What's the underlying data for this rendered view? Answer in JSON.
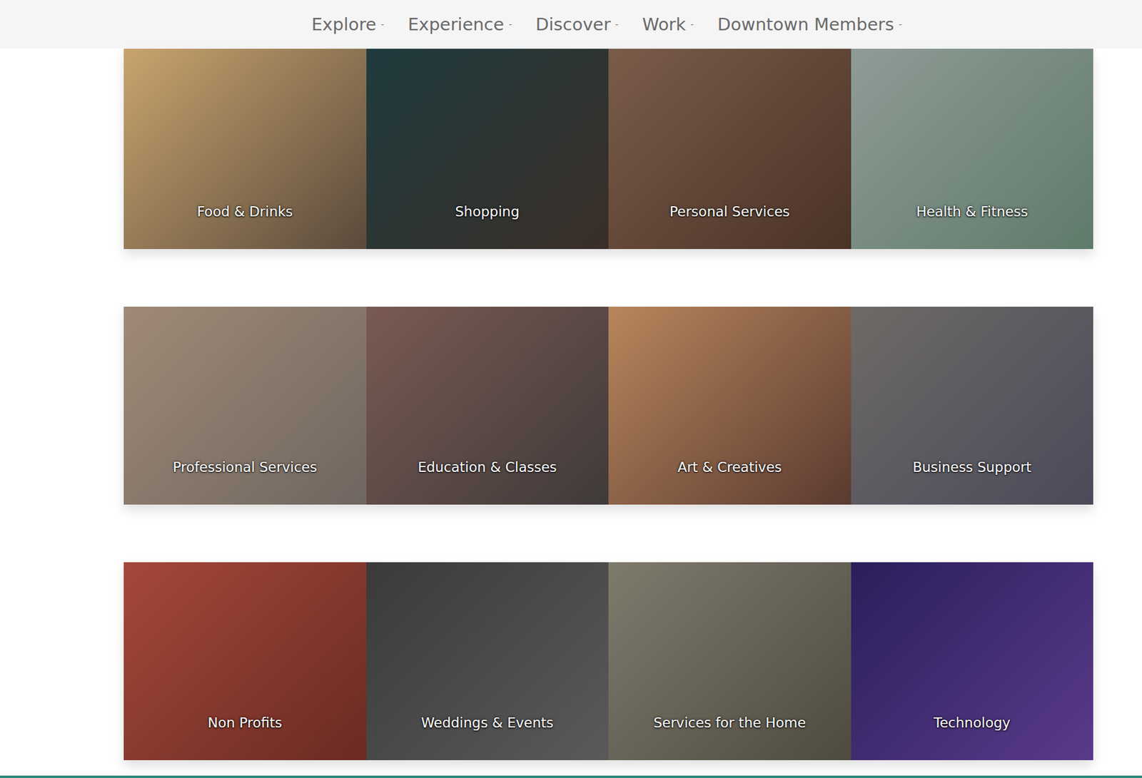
{
  "nav": {
    "items": [
      {
        "label": "Explore",
        "caret": "-"
      },
      {
        "label": "Experience",
        "caret": "-"
      },
      {
        "label": "Discover",
        "caret": "-"
      },
      {
        "label": "Work",
        "caret": "-"
      },
      {
        "label": "Downtown Members",
        "caret": "-"
      }
    ]
  },
  "categories": [
    {
      "label": "Food & Drinks"
    },
    {
      "label": "Shopping"
    },
    {
      "label": "Personal Services"
    },
    {
      "label": "Health & Fitness"
    },
    {
      "label": "Professional Services"
    },
    {
      "label": "Education & Classes"
    },
    {
      "label": "Art & Creatives"
    },
    {
      "label": "Business Support"
    },
    {
      "label": "Non Profits"
    },
    {
      "label": "Weddings & Events"
    },
    {
      "label": "Services for the Home"
    },
    {
      "label": "Technology"
    }
  ]
}
